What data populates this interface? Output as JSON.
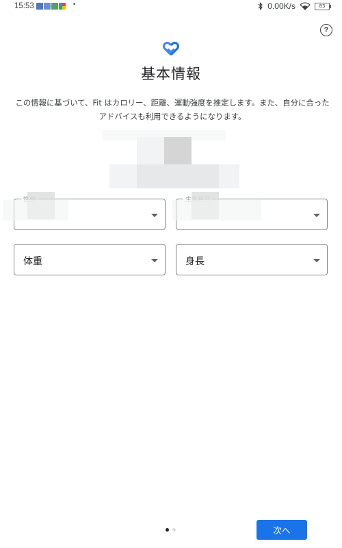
{
  "status_bar": {
    "time": "15:53",
    "more": "•",
    "net_speed": "0.00K/s",
    "battery": "83",
    "bluetooth_icon": "bluetooth-icon",
    "wifi_icon": "wifi-icon"
  },
  "header": {
    "help_label": "?",
    "title": "基本情報",
    "description": "この情報に基づいて、Fit はカロリー、距離、運動強度を推定します。また、自分に合ったアドバイスも利用できるようになります。"
  },
  "form": {
    "gender_label": "性別",
    "birthday_label": "生年月日",
    "weight_label": "体重",
    "height_label": "身長"
  },
  "footer": {
    "next_label": "次へ",
    "pages": 2,
    "current_page": 1
  },
  "colors": {
    "accent": "#1a73e8",
    "text": "#202124",
    "border": "#80868b"
  }
}
